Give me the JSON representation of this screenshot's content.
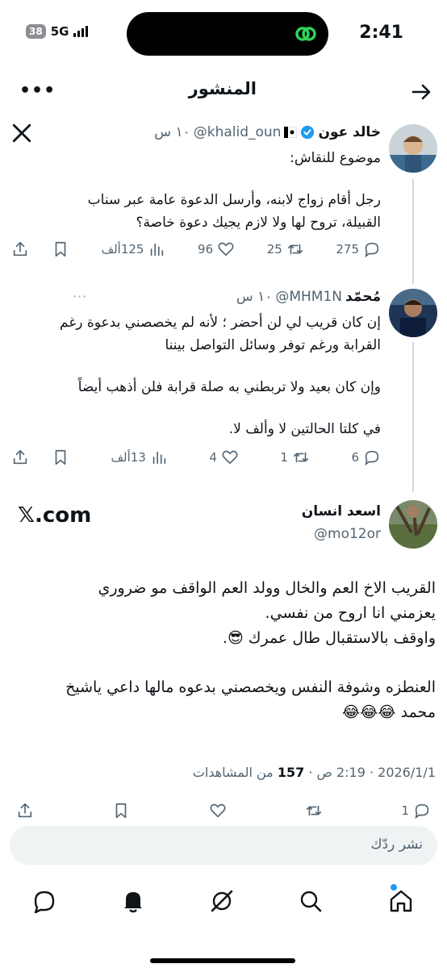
{
  "status_bar": {
    "battery": "38",
    "network": "5G",
    "time": "2:41"
  },
  "header": {
    "title": "المنشور",
    "more": "•••"
  },
  "post1": {
    "name": "خالد عون",
    "handle": "@khalid_oun",
    "time": "١٠ س",
    "line1": "موضوع للنقاش:",
    "line2": "رجل أقام زواج لابنه، وأرسل الدعوة عامة عبر سناب",
    "line3": "القبيلة، تروح لها ولا لازم يجيك دعوة خاصة؟",
    "replies": "275",
    "reposts": "25",
    "likes": "96",
    "views": "125ألف"
  },
  "post2": {
    "name": "مُحمّد",
    "handle": "@MHM1N",
    "time": "١٠ س",
    "line1": "إن كان قريب لي لن أحضر ؛ لأنه لم يخصصني بدعوة رغم",
    "line2": "القرابة ورغم توفر وسائل التواصل بيننا",
    "line3": "وإن كان بعيد ولا تربطني به صلة قرابة فلن أذهب أيضاً",
    "line4": "في كلتا الحالتين لا وألف لا.",
    "replies": "6",
    "reposts": "1",
    "likes": "4",
    "views": "13ألف",
    "more_dots": "···"
  },
  "post3": {
    "name": "اسعد انسان",
    "handle": "@mo12or",
    "xcom": "𝕏.com",
    "line1": "القريب الاخ العم  والخال وولد العم الواقف مو ضروري",
    "line2": "يعزمني انا اروح من نفسي.",
    "line3": "واوقف بالاستقبال طال عمرك 😎.",
    "line4": "العنطزه وشوفة النفس ويخصصني بدعوه مالها داعي ياشيخ",
    "line5": "محمد 😂😂😂",
    "date": "2026/1/1",
    "clock": "2:19 ص",
    "views_count": "157",
    "views_label": "من المشاهدات",
    "replies": "1"
  },
  "reply_bar": {
    "placeholder": "نشر ردّك"
  },
  "nav": {
    "items": [
      "home-icon",
      "search-icon",
      "grok-icon",
      "notifications-icon",
      "messages-icon"
    ]
  },
  "colors": {
    "accent": "#1d9bf0",
    "muted": "#536471",
    "island_green": "#30d158"
  }
}
